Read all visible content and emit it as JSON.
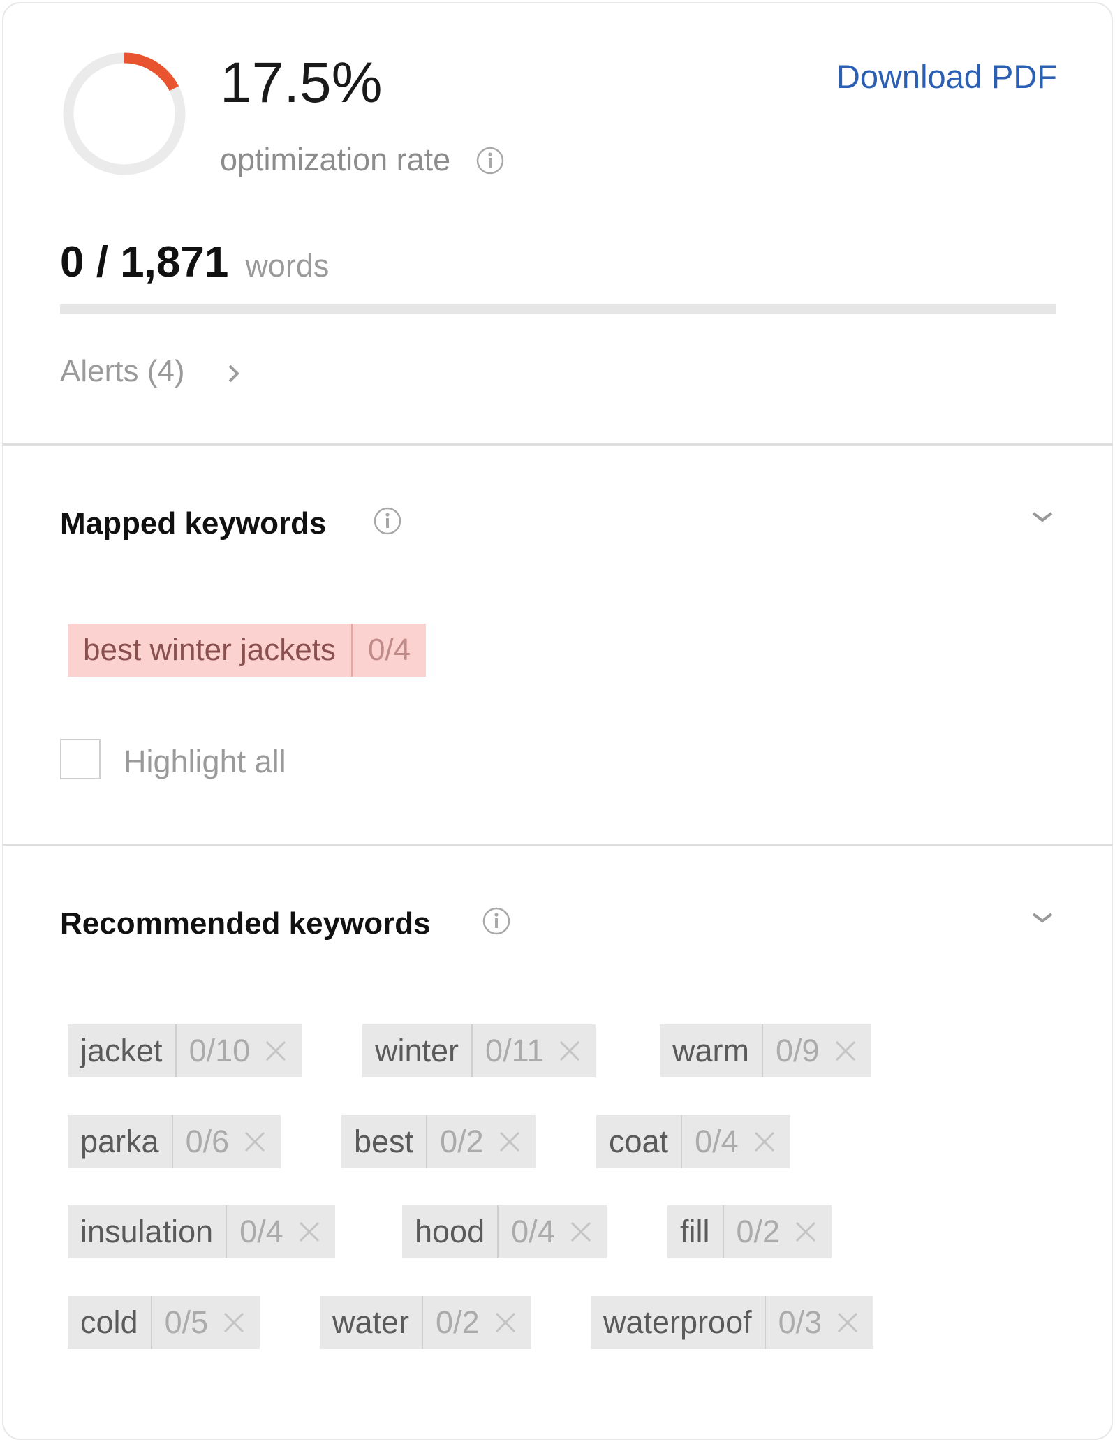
{
  "summary": {
    "rate": "17.5%",
    "rate_value": 0.175,
    "rate_label": "optimization rate",
    "download_label": "Download PDF",
    "word_count": "0 / 1,871",
    "word_unit": "words",
    "word_progress": 0,
    "alerts_label": "Alerts (4)"
  },
  "mapped": {
    "title": "Mapped keywords",
    "keywords": [
      {
        "keyword": "best winter jackets",
        "count": "0/4"
      }
    ],
    "highlight_label": "Highlight all"
  },
  "recommended": {
    "title": "Recommended keywords",
    "keywords": [
      {
        "keyword": "jacket",
        "count": "0/10"
      },
      {
        "keyword": "winter",
        "count": "0/11"
      },
      {
        "keyword": "warm",
        "count": "0/9"
      },
      {
        "keyword": "parka",
        "count": "0/6"
      },
      {
        "keyword": "best",
        "count": "0/2"
      },
      {
        "keyword": "coat",
        "count": "0/4"
      },
      {
        "keyword": "insulation",
        "count": "0/4"
      },
      {
        "keyword": "hood",
        "count": "0/4"
      },
      {
        "keyword": "fill",
        "count": "0/2"
      },
      {
        "keyword": "cold",
        "count": "0/5"
      },
      {
        "keyword": "water",
        "count": "0/2"
      },
      {
        "keyword": "waterproof",
        "count": "0/3"
      }
    ]
  },
  "colors": {
    "accent": "#e8542f",
    "link": "#2b5fb3",
    "mapped_chip": "#fbd2d0",
    "chip": "#e8e8e8"
  }
}
